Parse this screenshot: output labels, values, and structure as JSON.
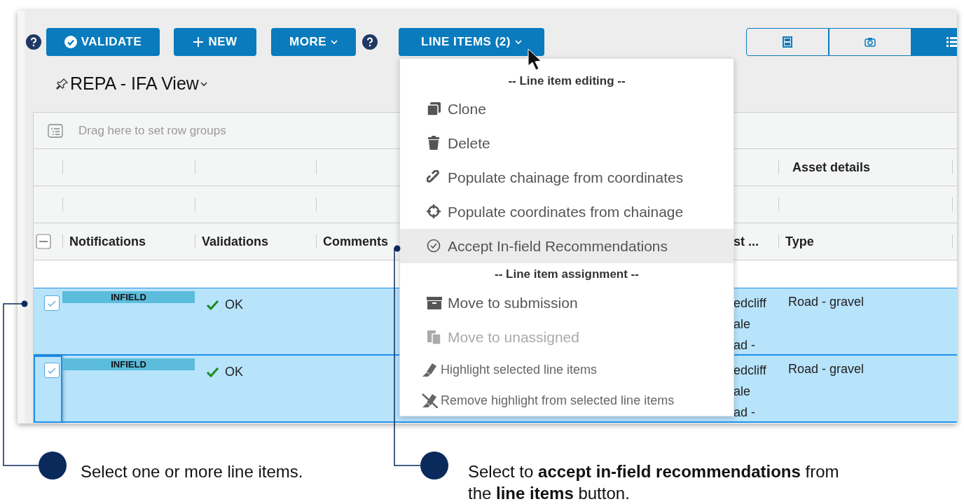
{
  "toolbar": {
    "buttons": [
      {
        "label": "VALIDATE",
        "kind": "validate"
      },
      {
        "label": "NEW",
        "kind": "new"
      },
      {
        "label": "MORE",
        "kind": "dropdown"
      },
      {
        "label": "LINE ITEMS (2)",
        "kind": "dropdown"
      }
    ]
  },
  "view_toggle": [
    {
      "kind": "form",
      "selected": false
    },
    {
      "kind": "camera",
      "selected": false
    },
    {
      "kind": "list",
      "selected": true
    }
  ],
  "view_title": "REPA - IFA View",
  "row_groups_placeholder": "Drag here to set row groups",
  "grid": {
    "group_header": "Asset details",
    "select_all_indeterminate": true,
    "columns": [
      {
        "label": "Notifications"
      },
      {
        "label": "Validations"
      },
      {
        "label": "Comments"
      },
      {
        "label": "st ..."
      },
      {
        "label": "Type"
      }
    ],
    "rows": [
      {
        "selected": true,
        "checked": true,
        "focused": false,
        "notification": "INFIELD",
        "validation": "OK",
        "location": [
          "edcliff",
          "ale",
          "ad -"
        ],
        "type": "Road - gravel"
      },
      {
        "selected": true,
        "checked": true,
        "focused": true,
        "notification": "INFIELD",
        "validation": "OK",
        "location": [
          "edcliff",
          "ale",
          "ad -"
        ],
        "type": "Road - gravel"
      }
    ]
  },
  "menu": {
    "items": [
      {
        "kind": "header",
        "label": "-- Line item editing --"
      },
      {
        "kind": "action",
        "label": "Clone",
        "selected": false,
        "disabled": false
      },
      {
        "kind": "action",
        "label": "Delete",
        "selected": false,
        "disabled": false
      },
      {
        "kind": "action",
        "label": "Populate chainage from coordinates",
        "selected": false,
        "disabled": false
      },
      {
        "kind": "action",
        "label": "Populate coordinates from chainage",
        "selected": false,
        "disabled": false
      },
      {
        "kind": "action",
        "label": "Accept In-field Recommendations",
        "selected": true,
        "disabled": false
      },
      {
        "kind": "header",
        "label": "-- Line item assignment --"
      },
      {
        "kind": "action",
        "label": "Move to submission",
        "selected": false,
        "disabled": false
      },
      {
        "kind": "action",
        "label": "Move to unassigned",
        "selected": false,
        "disabled": true
      },
      {
        "kind": "minor",
        "label": "Highlight selected line items",
        "selected": false,
        "disabled": false
      },
      {
        "kind": "minor",
        "label": "Remove highlight from selected line items",
        "selected": false,
        "disabled": false
      }
    ]
  },
  "callouts": [
    {
      "text": "Select one or more line items."
    },
    {
      "text": "Select to **accept in-field recommendations** from the **line items** button."
    }
  ]
}
